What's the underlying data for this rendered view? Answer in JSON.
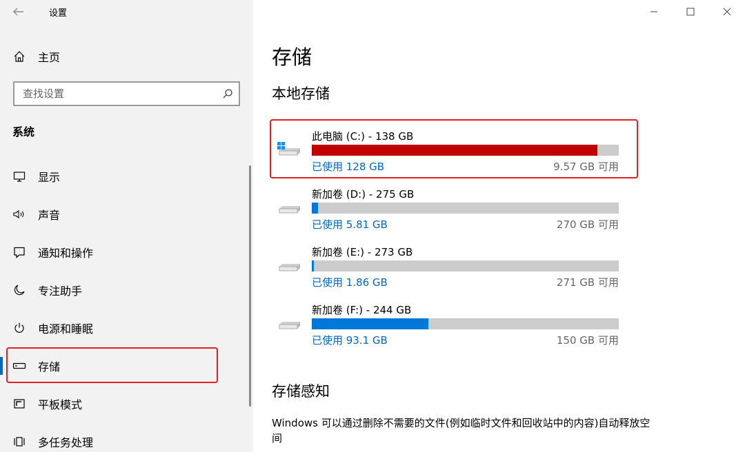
{
  "window": {
    "title": "设置"
  },
  "sidebar": {
    "home_label": "主页",
    "search_placeholder": "查找设置",
    "section_label": "系统",
    "items": [
      {
        "label": "显示",
        "icon": "monitor-icon"
      },
      {
        "label": "声音",
        "icon": "speaker-icon"
      },
      {
        "label": "通知和操作",
        "icon": "notification-icon"
      },
      {
        "label": "专注助手",
        "icon": "moon-icon"
      },
      {
        "label": "电源和睡眠",
        "icon": "power-icon"
      },
      {
        "label": "存储",
        "icon": "storage-icon",
        "selected": true
      },
      {
        "label": "平板模式",
        "icon": "tablet-icon"
      },
      {
        "label": "多任务处理",
        "icon": "multitask-icon"
      }
    ]
  },
  "main": {
    "page_title": "存储",
    "local_storage_title": "本地存储",
    "drives": [
      {
        "name": "此电脑 (C:) - 138 GB",
        "used": "已使用 128 GB",
        "free": "9.57 GB 可用",
        "used_fraction": 0.93,
        "color": "#c00000",
        "system": true
      },
      {
        "name": "新加卷 (D:) - 275 GB",
        "used": "已使用 5.81 GB",
        "free": "270 GB 可用",
        "used_fraction": 0.021,
        "color": "#0078d7",
        "system": false
      },
      {
        "name": "新加卷 (E:) - 273 GB",
        "used": "已使用 1.86 GB",
        "free": "271 GB 可用",
        "used_fraction": 0.007,
        "color": "#0078d7",
        "system": false
      },
      {
        "name": "新加卷 (F:) - 244 GB",
        "used": "已使用 93.1 GB",
        "free": "150 GB 可用",
        "used_fraction": 0.38,
        "color": "#0078d7",
        "system": false
      }
    ],
    "storage_sense_title": "存储感知",
    "storage_sense_desc": "Windows 可以通过删除不需要的文件(例如临时文件和回收站中的内容)自动释放空间"
  },
  "colors": {
    "accent": "#0067c0",
    "highlight": "#e02020"
  }
}
